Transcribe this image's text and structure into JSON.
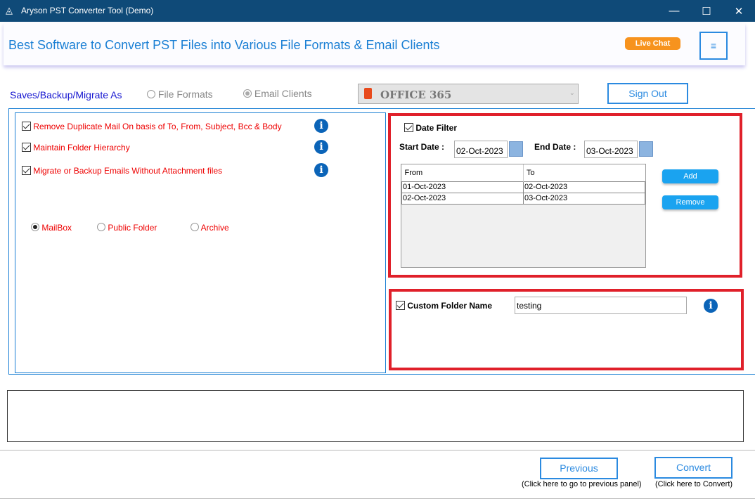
{
  "window": {
    "title": "Aryson PST Converter Tool (Demo)",
    "minimize": "—",
    "maximize": "☐",
    "close": "✕"
  },
  "banner": {
    "headline": "Best Software to Convert PST Files into Various File Formats & Email Clients",
    "live_chat": "Live Chat",
    "menu_icon": "≡"
  },
  "save_as": {
    "label": "Saves/Backup/Migrate As",
    "options": [
      {
        "label": "File Formats",
        "selected": false
      },
      {
        "label": "Email Clients",
        "selected": true
      }
    ],
    "client": "OFFICE 365",
    "sign_out": "Sign Out"
  },
  "options": {
    "items": [
      {
        "label": "Remove Duplicate Mail On basis of To, From, Subject, Bcc & Body",
        "checked": true
      },
      {
        "label": "Maintain Folder Hierarchy",
        "checked": true
      },
      {
        "label": "Migrate or Backup Emails Without Attachment files",
        "checked": true
      }
    ],
    "mailbox_types": [
      {
        "label": "MailBox",
        "selected": true
      },
      {
        "label": "Public Folder",
        "selected": false
      },
      {
        "label": "Archive",
        "selected": false
      }
    ]
  },
  "date_filter": {
    "label": "Date Filter",
    "checked": true,
    "start_label": "Start Date :",
    "start_value": "02-Oct-2023",
    "end_label": "End Date :",
    "end_value": "03-Oct-2023",
    "columns": [
      "From",
      "To"
    ],
    "rows": [
      [
        "01-Oct-2023",
        "02-Oct-2023"
      ],
      [
        "02-Oct-2023",
        "03-Oct-2023"
      ]
    ],
    "add": "Add",
    "remove": "Remove"
  },
  "custom_folder": {
    "label": "Custom Folder Name",
    "checked": true,
    "value": "testing"
  },
  "footer": {
    "previous": "Previous",
    "previous_hint": "(Click here to go to previous panel)",
    "convert": "Convert",
    "convert_hint": "(Click here to Convert)"
  },
  "colors": {
    "titlebar": "#0f4a78",
    "accent": "#2b8ae0",
    "highlight": "#e0202a",
    "option_text": "#e00000"
  }
}
